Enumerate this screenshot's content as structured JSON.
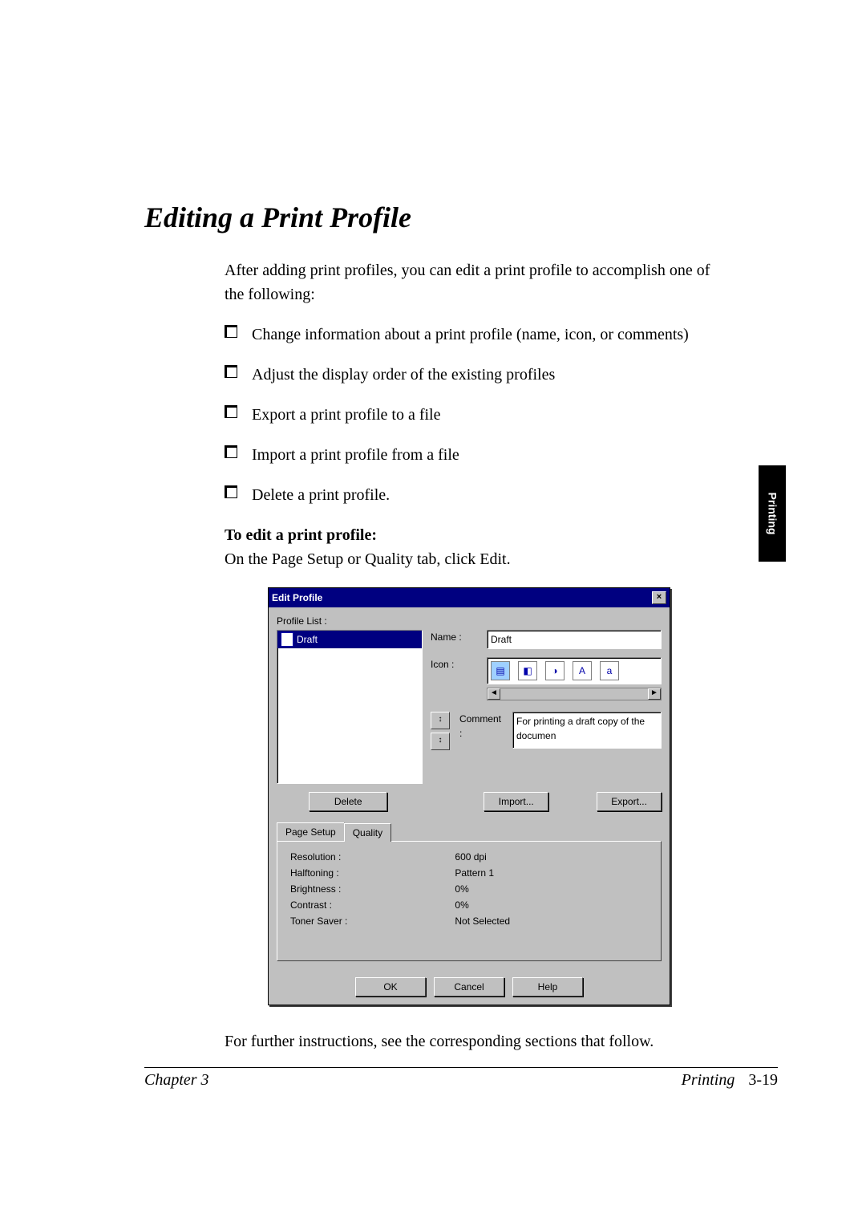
{
  "heading": "Editing a Print Profile",
  "intro": "After adding print profiles, you can edit a print profile to accomplish one of the following:",
  "bullets": [
    "Change information about a print profile (name, icon, or comments)",
    "Adjust the display order of the existing profiles",
    "Export a print profile to a file",
    "Import a print profile from a file",
    "Delete a print profile."
  ],
  "to_edit_label": "To edit a print profile:",
  "to_edit_text": "On the Page Setup or Quality tab, click Edit.",
  "closing": "For further instructions, see the corresponding sections that follow.",
  "side_tab": "Printing",
  "footer": {
    "left": "Chapter 3",
    "right": "Printing",
    "page": "3-19"
  },
  "dialog": {
    "title": "Edit Profile",
    "profile_list_label": "Profile List :",
    "selected_profile": "Draft",
    "name_label": "Name :",
    "name_value": "Draft",
    "icon_label": "Icon :",
    "comment_label": "Comment :",
    "comment_value": "For printing a draft copy of the documen",
    "delete_btn": "Delete",
    "import_btn": "Import...",
    "export_btn": "Export...",
    "tabs": [
      "Page Setup",
      "Quality"
    ],
    "active_tab": 1,
    "quality_rows": [
      [
        "Resolution :",
        "600 dpi"
      ],
      [
        "Halftoning :",
        "Pattern 1"
      ],
      [
        "Brightness :",
        "0%"
      ],
      [
        "Contrast :",
        "0%"
      ],
      [
        "Toner Saver :",
        "Not Selected"
      ]
    ],
    "ok": "OK",
    "cancel": "Cancel",
    "help": "Help"
  }
}
